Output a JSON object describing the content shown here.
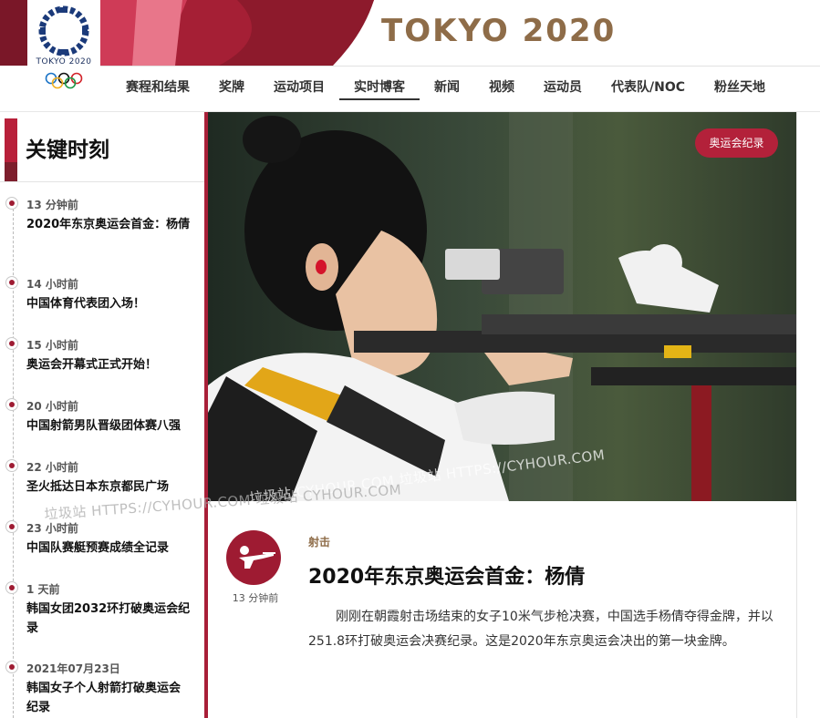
{
  "header": {
    "logo_text": "TOKYO 2020",
    "brand": "TOKYO 2020",
    "colors": {
      "brand_gold": "#8e6c48",
      "accent": "#9e1b32"
    }
  },
  "nav": {
    "items": [
      {
        "label": "赛程和结果"
      },
      {
        "label": "奖牌"
      },
      {
        "label": "运动项目"
      },
      {
        "label": "实时博客"
      },
      {
        "label": "新闻"
      },
      {
        "label": "视频"
      },
      {
        "label": "运动员"
      },
      {
        "label": "代表队/NOC"
      },
      {
        "label": "粉丝天地"
      }
    ],
    "active": "实时博客"
  },
  "sidebar": {
    "title": "关键时刻",
    "moments": [
      {
        "time": "13 分钟前",
        "title": "2020年东京奥运会首金：杨倩"
      },
      {
        "time": "14 小时前",
        "title": "中国体育代表团入场！"
      },
      {
        "time": "15 小时前",
        "title": "奥运会开幕式正式开始！"
      },
      {
        "time": "20 小时前",
        "title": "中国射箭男队晋级团体赛八强"
      },
      {
        "time": "22 小时前",
        "title": "圣火抵达日本东京都民广场"
      },
      {
        "time": "23 小时前",
        "title": "中国队赛艇预赛成绩全记录"
      },
      {
        "time": "1 天前",
        "title": "韩国女团2032环打破奥运会纪录"
      },
      {
        "time": "2021年07月23日",
        "title": "韩国女子个人射箭打破奥运会纪录"
      }
    ]
  },
  "hero": {
    "badge": "奥运会纪录",
    "watermark_1": "垃圾站 CYHOUR.COM   垃圾站 HTTPS://CYHOUR.COM",
    "watermark_2": "垃圾站 HTTPS://CYHOUR.COM   垃圾站 CYHOUR.COM",
    "icon": "athlete-photo"
  },
  "article": {
    "icon": "shooting-icon",
    "time": "13 分钟前",
    "category": "射击",
    "title": "2020年东京奥运会首金：杨倩",
    "body": "刚刚在朝霞射击场结束的女子10米气步枪决赛，中国选手杨倩夺得金牌，并以251.8环打破奥运会决赛纪录。这是2020年东京奥运会决出的第一块金牌。"
  }
}
